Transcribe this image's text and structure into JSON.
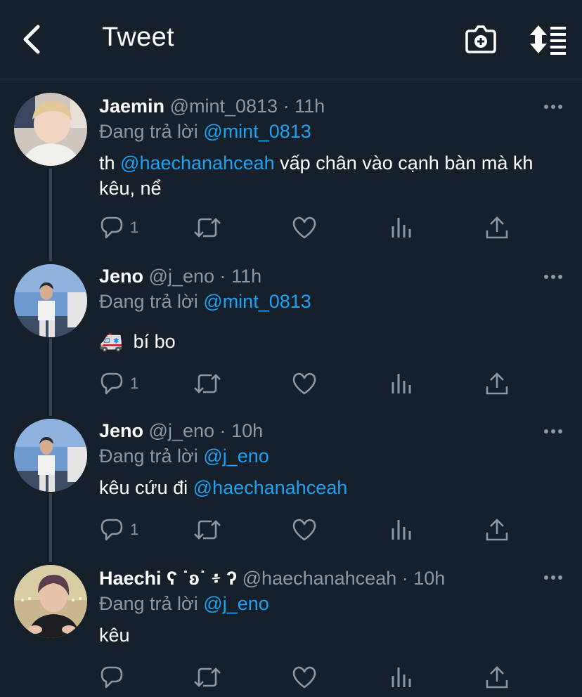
{
  "header": {
    "title": "Tweet",
    "back_icon": "chevron-left-icon",
    "camera_icon": "camera-add-icon",
    "sort_icon": "sort-icon"
  },
  "colors": {
    "background": "#15202b",
    "accent": "#1da1f2",
    "secondary_text": "#8899a6",
    "thread_line": "#38444d"
  },
  "tweets": [
    {
      "name": "Jaemin",
      "handle": "@mint_0813",
      "time": "11h",
      "reply_prefix": "Đang trả lời",
      "reply_to": "@mint_0813",
      "text_parts": [
        "th",
        "@haechanahceah",
        "vấp chân vào cạnh bàn mà kh kêu, nể"
      ],
      "reply_count": "1"
    },
    {
      "name": "Jeno",
      "handle": "@j_eno",
      "time": "11h",
      "reply_prefix": "Đang trả lời",
      "reply_to": "@mint_0813",
      "emoji": "🚑",
      "text": "bí bo",
      "reply_count": "1"
    },
    {
      "name": "Jeno",
      "handle": "@j_eno",
      "time": "10h",
      "reply_prefix": "Đang trả lời",
      "reply_to": "@j_eno",
      "text_parts": [
        "kêu cứu đi",
        "@haechanahceah"
      ],
      "reply_count": "1"
    },
    {
      "name": "Haechi ʕ ˙ʚ˙ ፥ ʔ",
      "handle": "@haechanahceah",
      "time": "10h",
      "reply_prefix": "Đang trả lời",
      "reply_to": "@j_eno",
      "text": "kêu",
      "reply_count": ""
    }
  ],
  "separator": "·",
  "action_icons": [
    "reply-icon",
    "retweet-icon",
    "like-icon",
    "analytics-icon",
    "share-icon"
  ]
}
